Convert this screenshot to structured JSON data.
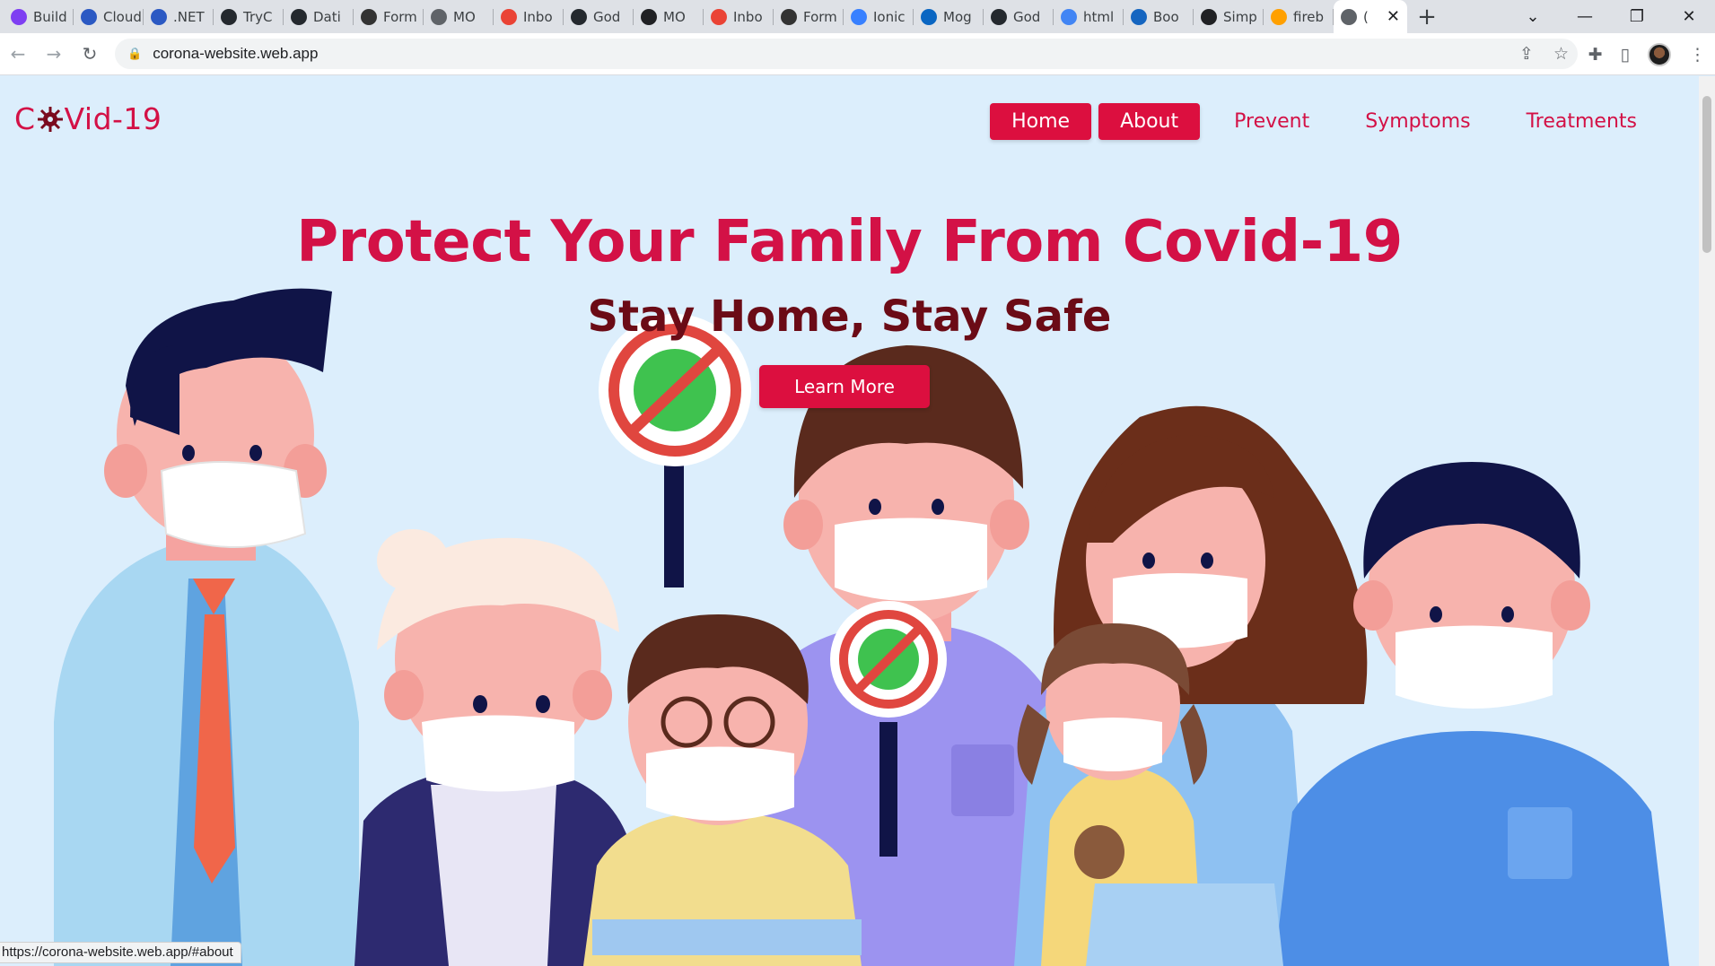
{
  "browser": {
    "tabs": [
      {
        "label": "Build",
        "icon": "u-circle-icon",
        "color": "#7e3ff2"
      },
      {
        "label": "Cloud",
        "icon": "azure-blue-icon",
        "color": "#2b59c3"
      },
      {
        "label": ".NET",
        "icon": "azure-blue-icon",
        "color": "#2b59c3"
      },
      {
        "label": "TryC",
        "icon": "github-icon",
        "color": "#24292e"
      },
      {
        "label": "Dati",
        "icon": "github-icon",
        "color": "#24292e"
      },
      {
        "label": "Form",
        "icon": "formik-icon",
        "color": "#333333"
      },
      {
        "label": "MO",
        "icon": "globe-icon",
        "color": "#5f6368"
      },
      {
        "label": "Inbo",
        "icon": "gmail-icon",
        "color": "#ea4335"
      },
      {
        "label": "God",
        "icon": "github-icon",
        "color": "#24292e"
      },
      {
        "label": "MO",
        "icon": "angular-icon",
        "color": "#202124"
      },
      {
        "label": "Inbo",
        "icon": "gmail-icon",
        "color": "#ea4335"
      },
      {
        "label": "Form",
        "icon": "formik-icon",
        "color": "#333333"
      },
      {
        "label": "Ionic",
        "icon": "ionic-icon",
        "color": "#3880ff"
      },
      {
        "label": "Mog",
        "icon": "linkedin-icon",
        "color": "#0a66c2"
      },
      {
        "label": "God",
        "icon": "github-icon",
        "color": "#24292e"
      },
      {
        "label": "html",
        "icon": "google-icon",
        "color": "#4285f4"
      },
      {
        "label": "Boo",
        "icon": "bootstrap-icon",
        "color": "#1565c0"
      },
      {
        "label": "Simp",
        "icon": "codepen-icon",
        "color": "#202124"
      },
      {
        "label": "fireb",
        "icon": "firebase-icon",
        "color": "#ffa000"
      },
      {
        "label": "(",
        "icon": "globe-icon",
        "color": "#5f6368",
        "active": true
      }
    ],
    "new_tab": "+",
    "url": "corona-website.web.app",
    "status_url": "https://corona-website.web.app/#about"
  },
  "site": {
    "logo": {
      "before": "C",
      "after": "Vid-19"
    },
    "nav": [
      {
        "label": "Home",
        "style": "button"
      },
      {
        "label": "About",
        "style": "button"
      },
      {
        "label": "Prevent",
        "style": "link"
      },
      {
        "label": "Symptoms",
        "style": "link"
      },
      {
        "label": "Treatments",
        "style": "link"
      }
    ],
    "hero": {
      "title": "Protect Your Family From Covid-19",
      "subtitle": "Stay Home, Stay Safe",
      "cta": "Learn More"
    },
    "colors": {
      "accent": "#dc0f3f",
      "text": "#d31146",
      "background": "#dceefc"
    }
  }
}
